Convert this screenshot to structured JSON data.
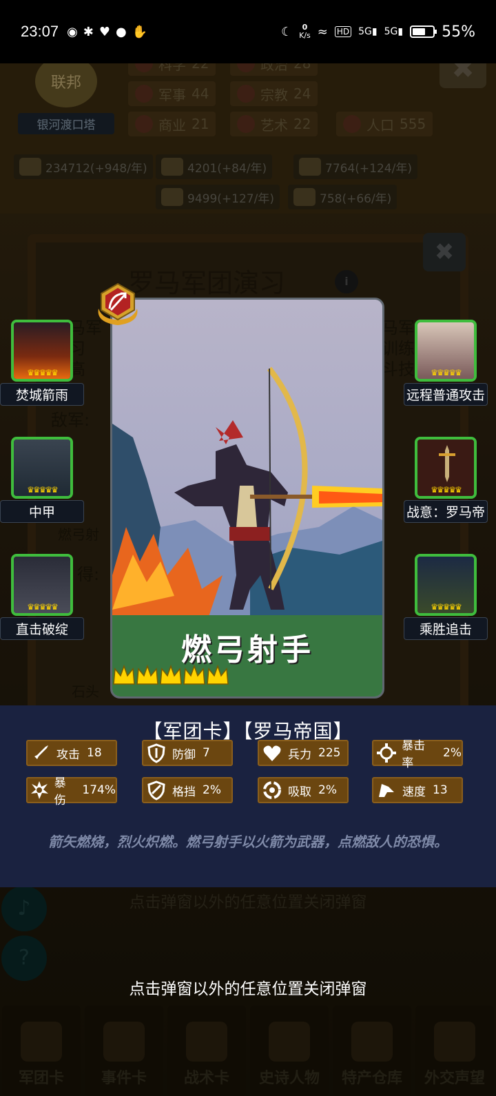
{
  "status_bar": {
    "time": "23:07",
    "net_speed_value": "0",
    "net_speed_unit": "K/s",
    "hd_label": "HD",
    "signal1_label": "5G",
    "signal2_label": "5G",
    "battery": "55%"
  },
  "background": {
    "faction_emblem": "联邦",
    "city_name": "银河渡口塔",
    "stats": [
      {
        "label": "科学",
        "value": "22"
      },
      {
        "label": "政治",
        "value": "28"
      },
      {
        "label": "军事",
        "value": "44"
      },
      {
        "label": "宗教",
        "value": "24"
      },
      {
        "label": "商业",
        "value": "21"
      },
      {
        "label": "艺术",
        "value": "22"
      },
      {
        "label": "人口",
        "value": "555"
      }
    ],
    "resources": [
      "234712(+948/年)",
      "4201(+84/年)",
      "7764(+124/年)",
      "9499(+127/年)",
      "758(+66/年)"
    ],
    "panel_title": "罗马军团演习",
    "panel_lines": [
      "罗马军",
      "演习",
      "提高",
      "马军",
      "训练,",
      "斗技",
      "敌军:",
      "燃弓射",
      "得:",
      "石头"
    ],
    "nav": [
      "军团卡",
      "事件卡",
      "战术卡",
      "史诗人物",
      "特产仓库",
      "外交声望"
    ],
    "hint_bg": "点击弹窗以外的任意位置关闭弹窗"
  },
  "card": {
    "name": "燃弓射手",
    "stars": 5,
    "tags": "【军团卡】【罗马帝国】",
    "description": "箭矢燃烧，烈火炽燃。燃弓射手以火箭为武器，点燃敌人的恐惧。",
    "stats": [
      {
        "label": "攻击",
        "value": "18",
        "icon": "sword-icon"
      },
      {
        "label": "防御",
        "value": "7",
        "icon": "shield-icon"
      },
      {
        "label": "兵力",
        "value": "225",
        "icon": "heart-icon"
      },
      {
        "label": "暴击率",
        "value": "2%",
        "icon": "crit-icon"
      },
      {
        "label": "暴伤",
        "value": "174%",
        "icon": "burst-icon"
      },
      {
        "label": "格挡",
        "value": "2%",
        "icon": "block-icon"
      },
      {
        "label": "吸取",
        "value": "2%",
        "icon": "drain-icon"
      },
      {
        "label": "速度",
        "value": "13",
        "icon": "speed-icon"
      }
    ]
  },
  "skills_left": [
    {
      "label": "焚城箭雨",
      "crowns": 5
    },
    {
      "label": "中甲",
      "crowns": 5
    },
    {
      "label": "直击破绽",
      "crowns": 5
    }
  ],
  "skills_right": [
    {
      "label": "远程普通攻击",
      "crowns": 5
    },
    {
      "label": "战意：罗马帝",
      "crowns": 5
    },
    {
      "label": "乘胜追击",
      "crowns": 5
    }
  ],
  "hint": "点击弹窗以外的任意位置关闭弹窗",
  "colors": {
    "panel": "#1a2240",
    "stat_bg": "#6b4610",
    "skill_border": "#3fbd3d",
    "crown": "#ffd400"
  }
}
